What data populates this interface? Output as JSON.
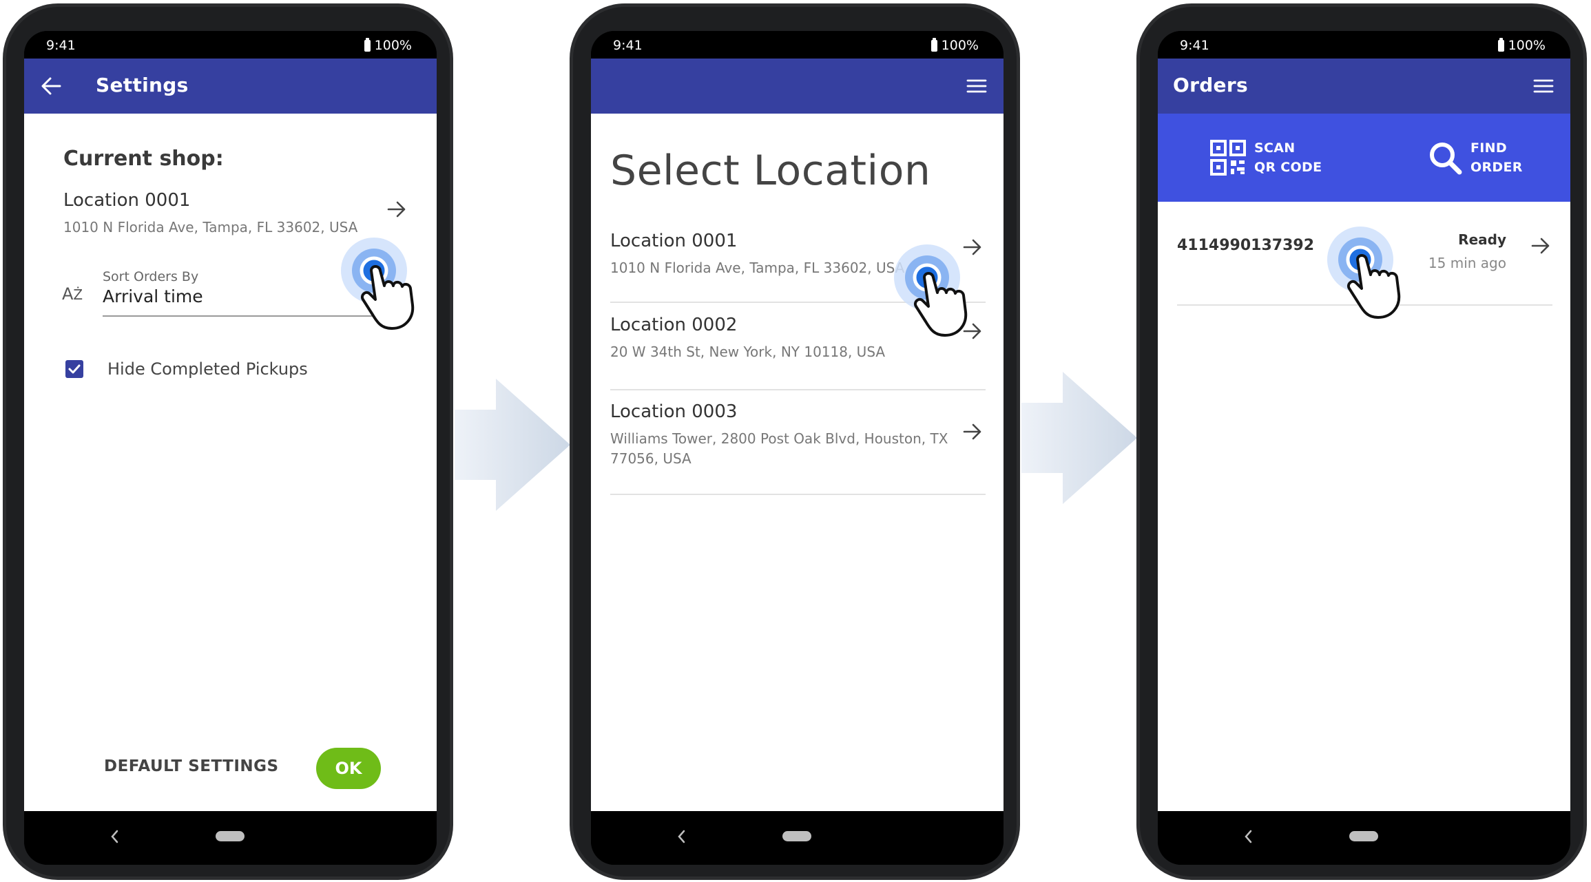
{
  "colors": {
    "appbar": "#3640a0",
    "action_bar": "#3f51e0",
    "ok_button": "#6fbc18"
  },
  "status_bar": {
    "time": "9:41",
    "battery": "100%"
  },
  "screen1": {
    "appbar_title": "Settings",
    "current_shop_label": "Current shop:",
    "location_name": "Location 0001",
    "location_address": "1010 N Florida Ave, Tampa, FL 33602, USA",
    "sort_label": "Sort Orders By",
    "sort_value": "Arrival time",
    "hide_completed_label": "Hide Completed Pickups",
    "hide_completed_checked": true,
    "default_settings_label": "DEFAULT SETTINGS",
    "ok_label": "OK"
  },
  "screen2": {
    "title": "Select Location",
    "locations": [
      {
        "name": "Location 0001",
        "address": "1010 N Florida Ave, Tampa, FL 33602, USA"
      },
      {
        "name": "Location 0002",
        "address": "20 W 34th St, New York, NY 10118, USA"
      },
      {
        "name": "Location 0003",
        "address": "Williams Tower, 2800 Post Oak Blvd, Houston, TX 77056, USA"
      }
    ]
  },
  "screen3": {
    "appbar_title": "Orders",
    "scan_label_1": "SCAN",
    "scan_label_2": "QR CODE",
    "find_label_1": "FIND",
    "find_label_2": "ORDER",
    "order": {
      "number": "4114990137392",
      "status": "Ready",
      "time": "15 min ago"
    }
  },
  "icons": [
    "back-arrow-icon",
    "menu-icon",
    "arrow-right-icon",
    "sort-az-icon",
    "checkbox-icon",
    "qr-code-icon",
    "search-icon",
    "tap-hand-icon",
    "nav-back-icon",
    "nav-home-icon"
  ]
}
